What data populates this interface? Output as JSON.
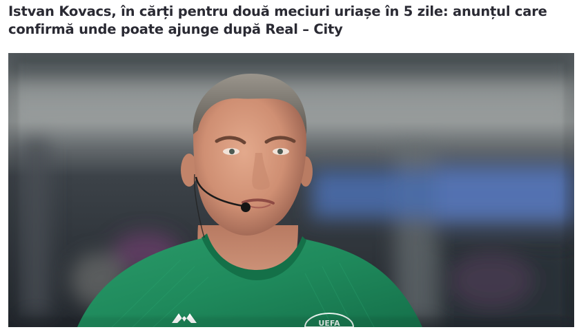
{
  "article": {
    "headline": "Istvan Kovacs, în cărți pentru două meciuri uriașe în 5 zile: anunțul care confirmă unde poate ajunge după Real – City",
    "photo": {
      "subject": "referee-portrait",
      "shirt_crest_text": "UEFA",
      "colors": {
        "shirt": "#1f8a5c",
        "background_dark": "#2b3036",
        "background_blue": "#4a6fb0"
      }
    }
  }
}
